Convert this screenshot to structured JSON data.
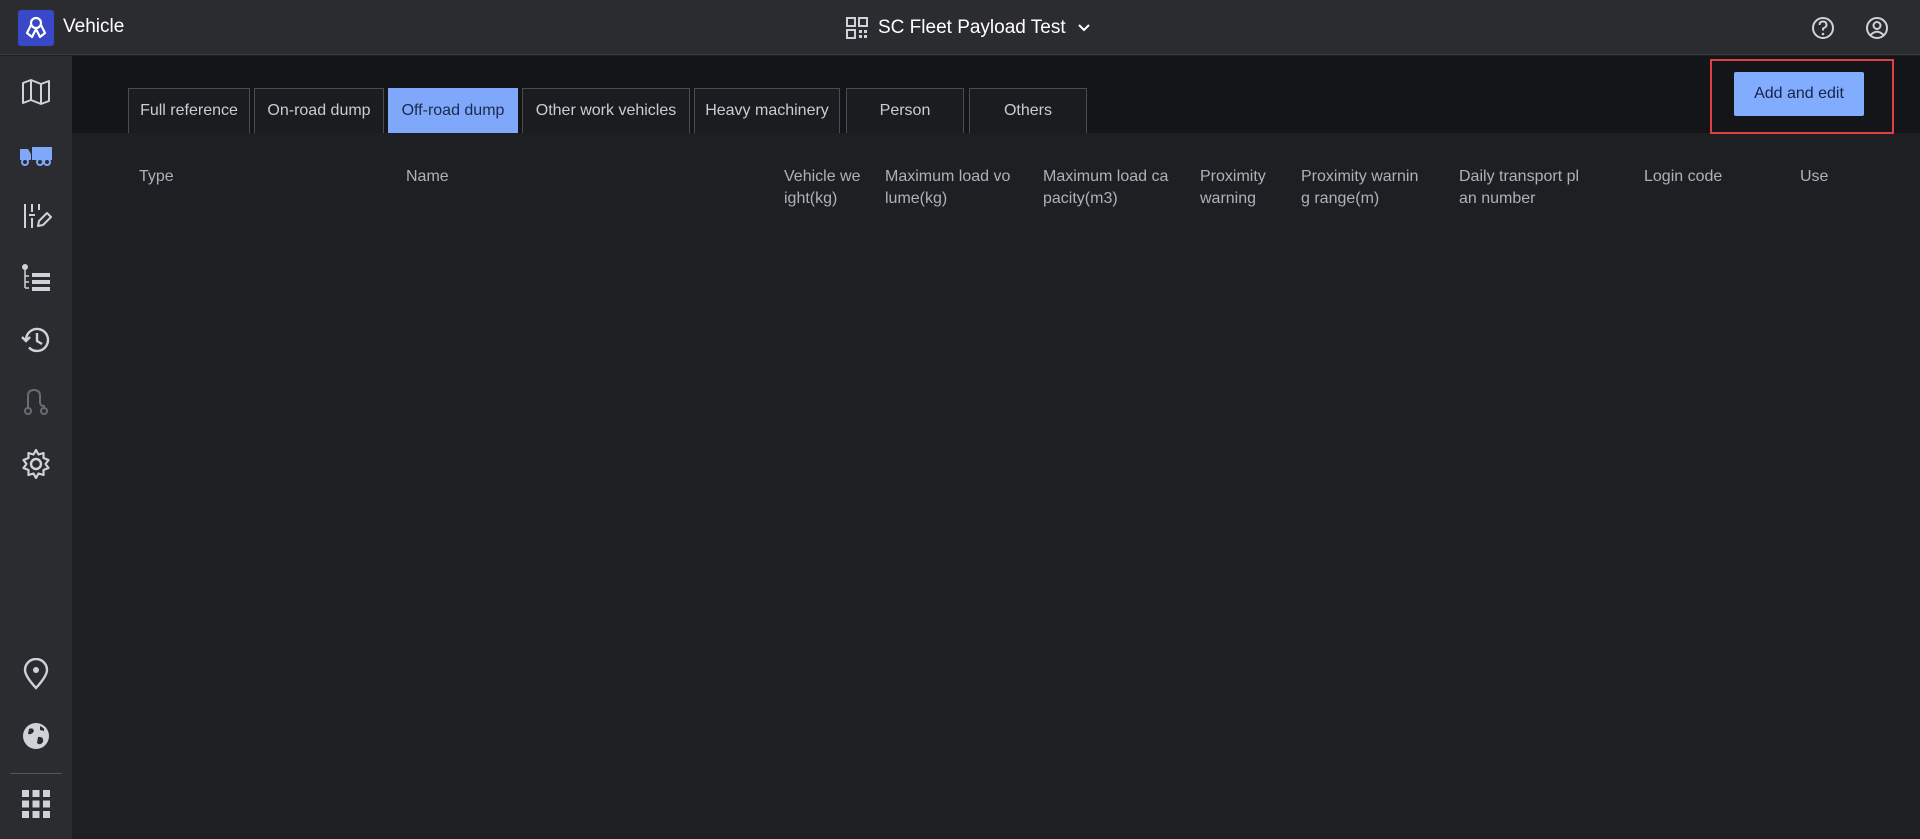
{
  "app": {
    "title": "Vehicle",
    "project": "SC Fleet Payload Test"
  },
  "header": {
    "logo_icon": "vehicle-logo-icon",
    "project_icon": "qr-code-icon",
    "dropdown_icon": "chevron-down-icon",
    "help_icon": "help-circle-icon",
    "user_icon": "user-circle-icon"
  },
  "sidebar": {
    "items": [
      {
        "name": "map",
        "icon": "map-icon",
        "active": false
      },
      {
        "name": "vehicle",
        "icon": "truck-icon",
        "active": true
      },
      {
        "name": "edit-settings",
        "icon": "sliders-edit-icon",
        "active": false
      },
      {
        "name": "list",
        "icon": "list-icon",
        "active": false
      },
      {
        "name": "history",
        "icon": "history-icon",
        "active": false
      },
      {
        "name": "route",
        "icon": "route-icon",
        "active": false,
        "disabled": true
      },
      {
        "name": "settings",
        "icon": "gear-icon",
        "active": false
      },
      {
        "name": "location",
        "icon": "map-pin-icon",
        "active": false
      },
      {
        "name": "globe",
        "icon": "globe-icon",
        "active": false
      },
      {
        "name": "apps",
        "icon": "grid-icon",
        "active": false
      }
    ]
  },
  "tabs": [
    {
      "label": "Full reference",
      "active": false
    },
    {
      "label": "On-road dump",
      "active": false
    },
    {
      "label": "Off-road dump",
      "active": true
    },
    {
      "label": "Other work vehicles",
      "active": false
    },
    {
      "label": "Heavy machinery",
      "active": false
    },
    {
      "label": "Person",
      "active": false
    },
    {
      "label": "Others",
      "active": false
    }
  ],
  "actions": {
    "add_edit_label": "Add and edit"
  },
  "table": {
    "columns": [
      [
        "Type"
      ],
      [
        "Name"
      ],
      [
        "Vehicle we",
        "ight(kg)"
      ],
      [
        "Maximum load vo",
        "lume(kg)"
      ],
      [
        "Maximum load ca",
        "pacity(m3)"
      ],
      [
        "Proximity",
        "warning"
      ],
      [
        "Proximity warnin",
        "g range(m)"
      ],
      [
        "Daily transport pl",
        "an number"
      ],
      [
        "Login code"
      ],
      [
        "Use"
      ]
    ],
    "rows": []
  },
  "colors": {
    "accent": "#7fa8fb",
    "highlight_border": "#e0403e",
    "logo_bg": "#3848c8"
  }
}
